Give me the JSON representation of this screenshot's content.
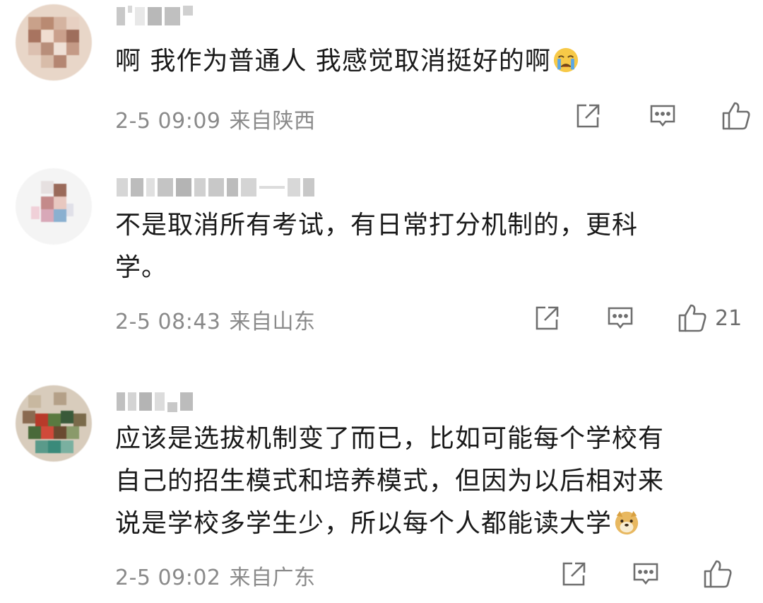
{
  "comments": [
    {
      "username_visible": "L' IOO'",
      "text_lines": [
        "啊 我作为普通人 我感觉取消挺好的啊"
      ],
      "emoji": "crying-face-icon",
      "date": "2-5 09:09",
      "location": "来自陕西",
      "like_count": ""
    },
    {
      "username_visible": "",
      "text_lines": [
        "不是取消所有考试，有日常打分机制的，更科",
        "学。"
      ],
      "emoji": "",
      "date": "2-5 08:43",
      "location": "来自山东",
      "like_count": "21"
    },
    {
      "username_visible": "",
      "text_lines": [
        "应该是选拔机制变了而已，比如可能每个学校有",
        "自己的招生模式和培养模式，但因为以后相对来",
        "说是学校多学生少，所以每个人都能读大学"
      ],
      "emoji": "doge-icon",
      "date": "2-5 09:02",
      "location": "来自广东",
      "like_count": ""
    }
  ],
  "icons": {
    "share": "share-icon",
    "reply": "comment-icon",
    "like": "thumbs-up-icon"
  },
  "colors": {
    "meta_text": "#8a8a8a",
    "body_text": "#1a1a1a",
    "icon_stroke": "#6e6e6e"
  }
}
